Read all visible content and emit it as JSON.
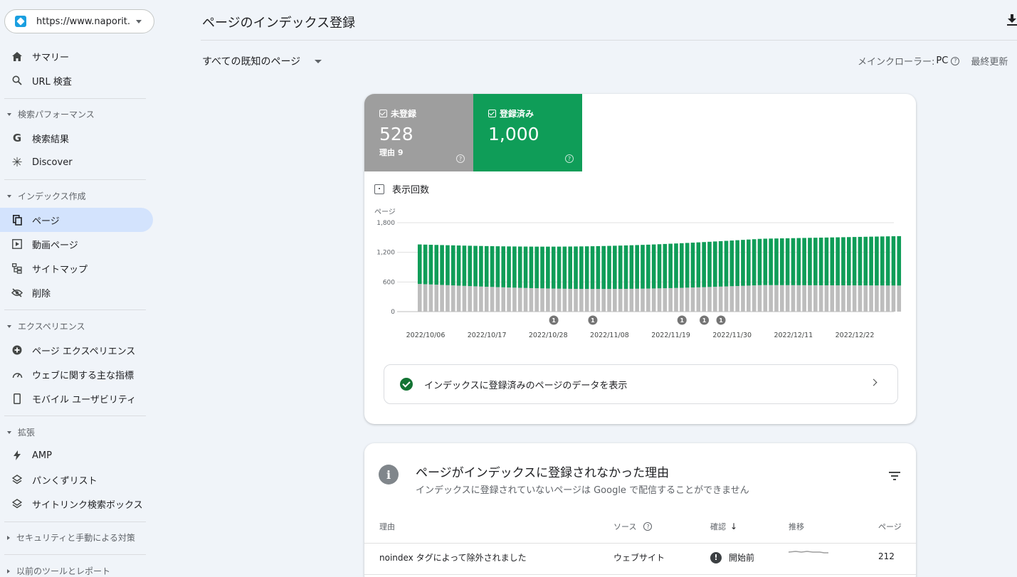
{
  "sidebar": {
    "property_url": "https://www.naporit...",
    "items": {
      "summary": "サマリー",
      "url_inspection": "URL 検査",
      "search_results": "検索結果",
      "discover": "Discover",
      "pages": "ページ",
      "video_pages": "動画ページ",
      "sitemaps": "サイトマップ",
      "removals": "削除",
      "page_experience": "ページ エクスペリエンス",
      "core_web_vitals": "ウェブに関する主な指標",
      "mobile_usability": "モバイル ユーザビリティ",
      "amp": "AMP",
      "breadcrumbs": "パンくずリスト",
      "sitelinks_searchbox": "サイトリンク検索ボックス"
    },
    "sections": {
      "search_performance": "検索パフォーマンス",
      "indexing": "インデックス作成",
      "experience": "エクスペリエンス",
      "enhancements": "拡張",
      "security": "セキュリティと手動による対策",
      "legacy": "以前のツールとレポート"
    }
  },
  "header": {
    "title": "ページのインデックス登録",
    "filter": "すべての既知のページ",
    "crawler_label": "メインクローラー:",
    "crawler_value": "PC",
    "last_update": "最終更新"
  },
  "summary": {
    "not_indexed": {
      "label": "未登録",
      "value": "528",
      "sub": "理由 9"
    },
    "indexed": {
      "label": "登録済み",
      "value": "1,000"
    },
    "impressions_toggle": "表示回数",
    "view_data_link": "インデックスに登録済みのページのデータを表示"
  },
  "chart_data": {
    "type": "bar",
    "stacked": true,
    "ylabel": "ページ",
    "ylim": [
      0,
      1800
    ],
    "yticks": [
      "0",
      "600",
      "1,200",
      "1,800"
    ],
    "xtick_labels": [
      "2022/10/06",
      "2022/10/17",
      "2022/10/28",
      "2022/11/08",
      "2022/11/19",
      "2022/11/30",
      "2022/12/11",
      "2022/12/22"
    ],
    "xtick_dates": [
      "2022-10-06",
      "2022-10-17",
      "2022-10-28",
      "2022-11-08",
      "2022-11-19",
      "2022-11-30",
      "2022-12-11",
      "2022-12-22"
    ],
    "date_range": [
      "2022-10-01",
      "2022-12-31"
    ],
    "annotation_dates": [
      "2022-10-29",
      "2022-11-05",
      "2022-11-21",
      "2022-11-25",
      "2022-11-28"
    ],
    "annotation_label": "1",
    "series": [
      {
        "name": "未登録",
        "color": "#bdbdbd",
        "start": 560,
        "end": 528,
        "min": 460
      },
      {
        "name": "登録済み",
        "color": "#0f9d58",
        "start": 800,
        "end": 1000
      }
    ]
  },
  "reasons": {
    "title": "ページがインデックスに登録されなかった理由",
    "subtitle": "インデックスに登録されていないページは Google で配信することができません",
    "columns": {
      "reason": "理由",
      "source": "ソース",
      "validation": "確認",
      "trend": "推移",
      "pages": "ページ"
    },
    "rows": [
      {
        "reason": "noindex タグによって除外されました",
        "source": "ウェブサイト",
        "validation": "開始前",
        "pages": "212"
      }
    ]
  }
}
